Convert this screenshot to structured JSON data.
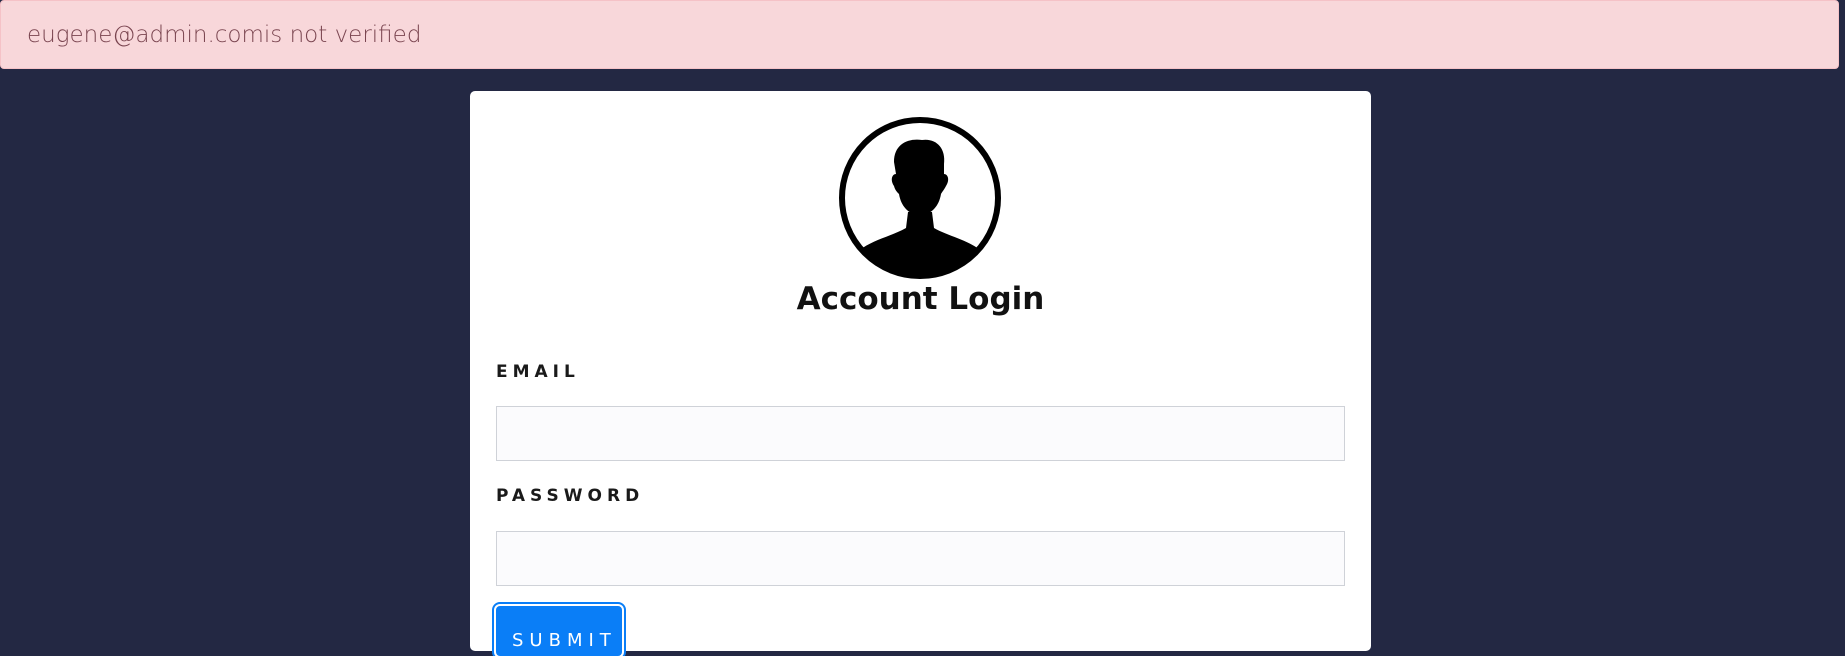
{
  "alert": {
    "message": "eugene@admin.comis not verified"
  },
  "login_card": {
    "title": "Account Login",
    "email_label": "EMAIL",
    "email_value": "",
    "password_label": "PASSWORD",
    "password_value": "",
    "submit_label": "SUBMIT",
    "avatar_icon": "user-avatar-icon"
  },
  "colors": {
    "page_background": "#232843",
    "alert_background": "#f8d7da",
    "alert_text": "#7a4550",
    "submit_button": "#0a7ef7"
  }
}
